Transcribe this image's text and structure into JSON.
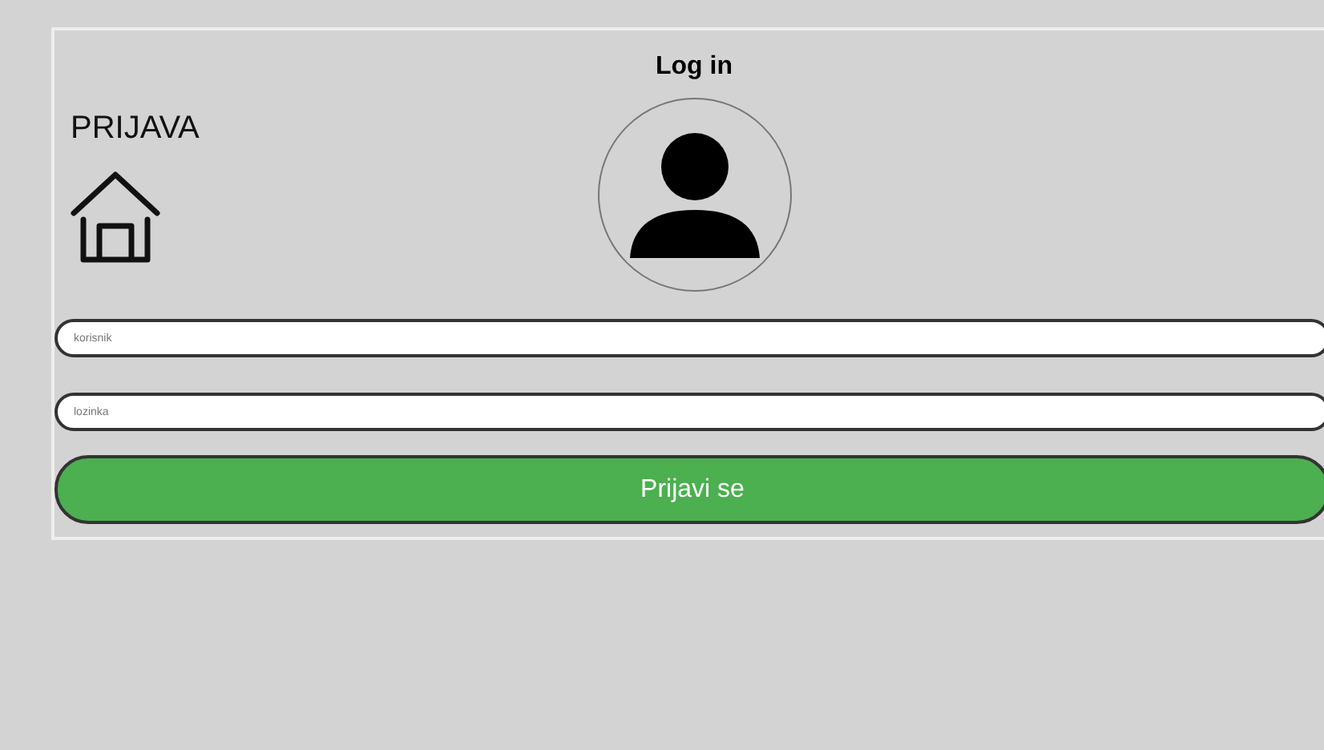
{
  "title": "Log in",
  "heading": "PRIJAVA",
  "fields": [
    {
      "placeholder": "korisnik"
    },
    {
      "placeholder": "lozinka"
    }
  ],
  "button": "Prijavi se"
}
